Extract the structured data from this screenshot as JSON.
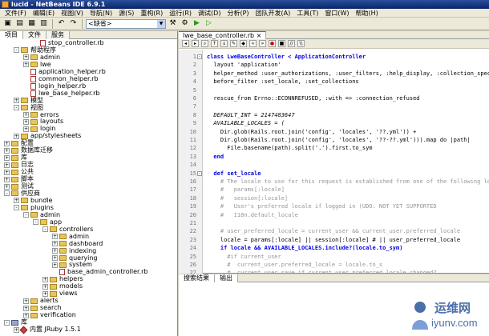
{
  "window": {
    "title": "lucid - NetBeans IDE 6.9.1"
  },
  "menu": [
    "文件(F)",
    "编辑(E)",
    "视图(V)",
    "导航(N)",
    "源(S)",
    "重构(R)",
    "运行(R)",
    "调试(D)",
    "分析(P)",
    "团队开发(A)",
    "工具(T)",
    "窗口(W)",
    "帮助(H)"
  ],
  "toolbar": {
    "config_value": "<缺省>"
  },
  "left_tabs": [
    "项目",
    "文件",
    "服务"
  ],
  "tree": [
    {
      "label": "stop_controller.rb",
      "level": 3,
      "kind": "file",
      "exp": ""
    },
    {
      "label": "帮助程序",
      "level": 1,
      "kind": "folder",
      "exp": "-"
    },
    {
      "label": "admin",
      "level": 2,
      "kind": "folder",
      "exp": "+"
    },
    {
      "label": "lwe",
      "level": 2,
      "kind": "folder",
      "exp": "+"
    },
    {
      "label": "application_helper.rb",
      "level": 2,
      "kind": "file",
      "exp": ""
    },
    {
      "label": "common_helper.rb",
      "level": 2,
      "kind": "file",
      "exp": ""
    },
    {
      "label": "login_helper.rb",
      "level": 2,
      "kind": "file",
      "exp": ""
    },
    {
      "label": "lwe_base_helper.rb",
      "level": 2,
      "kind": "file",
      "exp": ""
    },
    {
      "label": "模型",
      "level": 1,
      "kind": "folder",
      "exp": "+"
    },
    {
      "label": "视图",
      "level": 1,
      "kind": "folder",
      "exp": "-"
    },
    {
      "label": "errors",
      "level": 2,
      "kind": "folder",
      "exp": "+"
    },
    {
      "label": "layouts",
      "level": 2,
      "kind": "folder",
      "exp": "+"
    },
    {
      "label": "login",
      "level": 2,
      "kind": "folder",
      "exp": "+"
    },
    {
      "label": "app/stylesheets",
      "level": 1,
      "kind": "folder",
      "exp": "+"
    },
    {
      "label": "配置",
      "level": 0,
      "kind": "folder",
      "exp": "+"
    },
    {
      "label": "数据库迁移",
      "level": 0,
      "kind": "folder",
      "exp": "+"
    },
    {
      "label": "库",
      "level": 0,
      "kind": "folder",
      "exp": "+"
    },
    {
      "label": "日志",
      "level": 0,
      "kind": "folder",
      "exp": "+"
    },
    {
      "label": "公共",
      "level": 0,
      "kind": "folder",
      "exp": "+"
    },
    {
      "label": "脚本",
      "level": 0,
      "kind": "folder",
      "exp": "+"
    },
    {
      "label": "测试",
      "level": 0,
      "kind": "folder",
      "exp": "+"
    },
    {
      "label": "供应商",
      "level": 0,
      "kind": "folder",
      "exp": "-"
    },
    {
      "label": "bundle",
      "level": 1,
      "kind": "folder",
      "exp": "+"
    },
    {
      "label": "plugins",
      "level": 1,
      "kind": "folder",
      "exp": "-"
    },
    {
      "label": "admin",
      "level": 2,
      "kind": "folder",
      "exp": "-"
    },
    {
      "label": "app",
      "level": 3,
      "kind": "folder",
      "exp": "-"
    },
    {
      "label": "controllers",
      "level": 4,
      "kind": "folder",
      "exp": "-"
    },
    {
      "label": "admin",
      "level": 5,
      "kind": "folder",
      "exp": "+"
    },
    {
      "label": "dashboard",
      "level": 5,
      "kind": "folder",
      "exp": "+"
    },
    {
      "label": "indexing",
      "level": 5,
      "kind": "folder",
      "exp": "+"
    },
    {
      "label": "querying",
      "level": 5,
      "kind": "folder",
      "exp": "+"
    },
    {
      "label": "system",
      "level": 5,
      "kind": "folder",
      "exp": "+"
    },
    {
      "label": "base_admin_controller.rb",
      "level": 5,
      "kind": "file",
      "exp": ""
    },
    {
      "label": "helpers",
      "level": 4,
      "kind": "folder",
      "exp": "+"
    },
    {
      "label": "models",
      "level": 4,
      "kind": "folder",
      "exp": "+"
    },
    {
      "label": "views",
      "level": 4,
      "kind": "folder",
      "exp": "+"
    },
    {
      "label": "alerts",
      "level": 2,
      "kind": "folder",
      "exp": "+"
    },
    {
      "label": "search",
      "level": 2,
      "kind": "folder",
      "exp": "+"
    },
    {
      "label": "verification",
      "level": 2,
      "kind": "folder",
      "exp": "+"
    },
    {
      "label": "库",
      "level": 0,
      "kind": "lib",
      "exp": "-"
    },
    {
      "label": "内置 JRuby 1.5.1",
      "level": 1,
      "kind": "gem",
      "exp": "+"
    }
  ],
  "editor_tab": "lwe_base_controller.rb",
  "code": [
    {
      "n": "1",
      "t": "class LweBaseController < ApplicationController",
      "c": "kw-first",
      "fold": "-"
    },
    {
      "n": "2",
      "t": "  layout 'application'",
      "c": "plain"
    },
    {
      "n": "3",
      "t": "  helper_method :user_authorizations, :user_filters, :help_display, :collection_spec",
      "c": "plain"
    },
    {
      "n": "4",
      "t": "  before_filter :set_locale, :set_collections",
      "c": "plain"
    },
    {
      "n": "5",
      "t": "",
      "c": "plain"
    },
    {
      "n": "6",
      "t": "  rescue_from Errno::ECONNREFUSED, :with => :connection_refused",
      "c": "plain"
    },
    {
      "n": "7",
      "t": "",
      "c": "plain"
    },
    {
      "n": "8",
      "t": "  DEFAULT_INT = 2147483647",
      "c": "const"
    },
    {
      "n": "9",
      "t": "  AVAILABLE_LOCALES = (",
      "c": "const"
    },
    {
      "n": "10",
      "t": "    Dir.glob(Rails.root.join('config', 'locales', '??.yml')) +",
      "c": "plain"
    },
    {
      "n": "11",
      "t": "    Dir.glob(Rails.root.join('config', 'locales', '??-??.yml'))).map do |path|",
      "c": "plain"
    },
    {
      "n": "12",
      "t": "      File.basename(path).split('.').first.to_sym",
      "c": "plain"
    },
    {
      "n": "13",
      "t": "  end",
      "c": "kw"
    },
    {
      "n": "14",
      "t": "",
      "c": "plain"
    },
    {
      "n": "15",
      "t": "  def set_locale",
      "c": "kw",
      "fold": "-"
    },
    {
      "n": "16",
      "t": "    # The locale to use for this request is established from one of the following loca",
      "c": "cm"
    },
    {
      "n": "17",
      "t": "    #   params[:locale]",
      "c": "cm"
    },
    {
      "n": "18",
      "t": "    #   session[:locale]",
      "c": "cm"
    },
    {
      "n": "19",
      "t": "    #   User's preferred locale if logged in (UDO: NOT YET SUPPORTED",
      "c": "cm"
    },
    {
      "n": "20",
      "t": "    #   I18n.default_locale",
      "c": "cm"
    },
    {
      "n": "21",
      "t": "",
      "c": "plain"
    },
    {
      "n": "22",
      "t": "    # user_preferred_locale = current_user && current_user.preferred_locale",
      "c": "cm"
    },
    {
      "n": "23",
      "t": "    locale = params[:locale] || session[:locale] # || user_preferred_locale",
      "c": "plain"
    },
    {
      "n": "24",
      "t": "    if locale && AVAILABLE_LOCALES.include?(locale.to_sym)",
      "c": "kw"
    },
    {
      "n": "25",
      "t": "      #if current_user",
      "c": "cm"
    },
    {
      "n": "26",
      "t": "      #  current_user.preferred_locale = locale.to_s",
      "c": "cm"
    },
    {
      "n": "27",
      "t": "      #  current_user.save if current_user.preferred_locale_changed?",
      "c": "cm"
    }
  ],
  "bottom_tabs": [
    "搜索结果",
    "输出"
  ],
  "watermark": {
    "line1": "运维网",
    "line2": "iyunv.com"
  }
}
